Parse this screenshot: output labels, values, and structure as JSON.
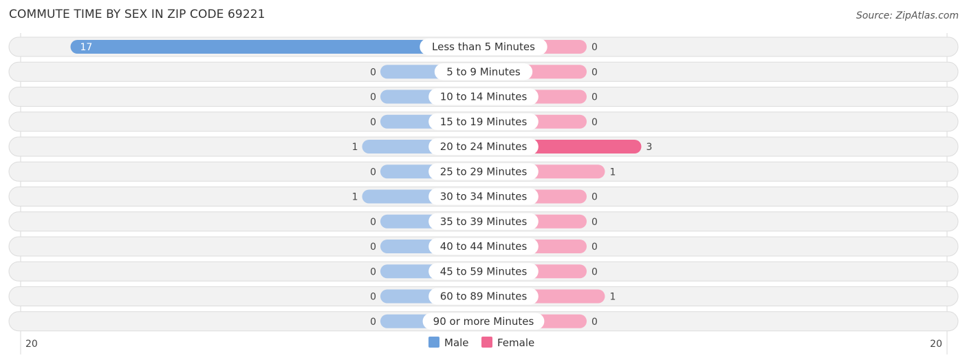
{
  "header": {
    "title": "COMMUTE TIME BY SEX IN ZIP CODE 69221",
    "source": "Source: ZipAtlas.com"
  },
  "colors": {
    "male": "#6a9fdc",
    "male_light": "#a9c6ea",
    "female": "#f06791",
    "female_light": "#f7a8c1"
  },
  "chart_data": {
    "type": "bar",
    "orientation": "horizontal-diverging",
    "title": "COMMUTE TIME BY SEX IN ZIP CODE 69221",
    "categories": [
      "Less than 5 Minutes",
      "5 to 9 Minutes",
      "10 to 14 Minutes",
      "15 to 19 Minutes",
      "20 to 24 Minutes",
      "25 to 29 Minutes",
      "30 to 34 Minutes",
      "35 to 39 Minutes",
      "40 to 44 Minutes",
      "45 to 59 Minutes",
      "60 to 89 Minutes",
      "90 or more Minutes"
    ],
    "series": [
      {
        "name": "Male",
        "values": [
          17,
          0,
          0,
          0,
          1,
          0,
          1,
          0,
          0,
          0,
          0,
          0
        ]
      },
      {
        "name": "Female",
        "values": [
          0,
          0,
          0,
          0,
          3,
          1,
          0,
          0,
          0,
          0,
          1,
          0
        ]
      }
    ],
    "axis": {
      "left_label": "20",
      "right_label": "20",
      "max": 20
    },
    "legend": {
      "position": "bottom-center",
      "items": [
        "Male",
        "Female"
      ]
    }
  }
}
